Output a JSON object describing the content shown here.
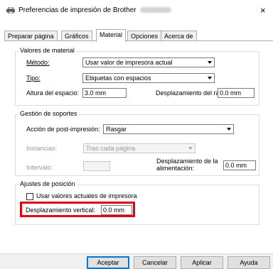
{
  "window": {
    "title": "Preferencias de impresión de Brother",
    "close": "×"
  },
  "tabs": [
    "Preparar página",
    "Gráficos",
    "Material",
    "Opciones",
    "Acerca de"
  ],
  "valores": {
    "title": "Valores de material",
    "metodo_label": "Método:",
    "metodo_value": "Usar valor de impresora actual",
    "tipo_label": "Tipo:",
    "tipo_value": "Etiquetas con espacios",
    "altura_label": "Altura del espacio:",
    "altura_value": "3.0 mm",
    "desplazamiento_label": "Desplazamiento del rango:",
    "desplazamiento_value": "0.0 mm"
  },
  "gestion": {
    "title": "Gestión de soportes",
    "accion_label": "Acción de post-impresión:",
    "accion_value": "Rasgar",
    "instancias_label": "Instancias:",
    "instancias_value": "Tras cada página",
    "intervalo_label": "Intervalo:",
    "alimentacion_label_1": "Desplazamiento de la",
    "alimentacion_label_2": "alimentación:",
    "alimentacion_value": "0.0 mm"
  },
  "ajustes": {
    "title": "Ajustes de posición",
    "usar_label": "Usar valores actuales de impresora",
    "vertical_label": "Desplazamiento vertical:",
    "vertical_value": "0.0 mm"
  },
  "buttons": {
    "ok": "Aceptar",
    "cancel": "Cancelar",
    "apply": "Aplicar",
    "help": "Ayuda"
  },
  "icons": {
    "title": "printer-icon"
  },
  "colors": {
    "highlight": "#e1000f",
    "accent": "#0078d7"
  }
}
